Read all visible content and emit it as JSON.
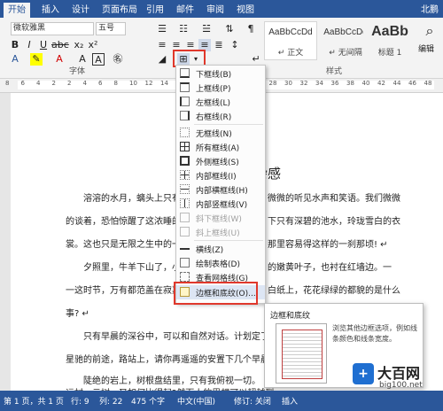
{
  "tabs": [
    "开始",
    "插入",
    "设计",
    "页面布局",
    "引用",
    "邮件",
    "审阅",
    "视图"
  ],
  "active_tab": "开始",
  "user_hint": "北鹏",
  "ribbon": {
    "font_name": "微软雅黑",
    "font_size": "五号",
    "font_group": "字体",
    "styles_group": "样式",
    "editing_label": "编辑",
    "styles": [
      {
        "preview": "AaBbCcDd",
        "name": "↵ 正文"
      },
      {
        "preview": "AaBbCcDd",
        "name": "↵ 无间隔"
      },
      {
        "preview": "AaBb",
        "name": "标题 1"
      }
    ]
  },
  "ruler_ticks": [
    "8",
    "6",
    "4",
    "2",
    "2",
    "4",
    "6",
    "8",
    "10",
    "12",
    "14",
    "16",
    "18",
    "20",
    "22",
    "24",
    "26",
    "28",
    "30",
    "32",
    "34",
    "36",
    "38",
    "40",
    "42",
    "44",
    "46",
    "48"
  ],
  "document": {
    "title_fragment": "中杂感",
    "lines": [
      "溶溶的水月，螭头上只有",
      "微微的听见水声和笑语。我们微微",
      "的谈着，恐怕惊醒了这浓睡的世",
      "下只有深碧的池水，玲珑雪白的衣",
      "裳。这也只是无限之生中的一",
      "那里容易得这样的一刹那顷! ↵",
      "夕照里，牛羊下山了，小",
      "的嫩黄叶子，也衬在红墙边。一",
      "一这时节，万有都范盖在寂嘉",
      "白纸上，花花绿绿的都貌的是什么",
      "事? ↵",
      "只有早晨的深谷中，可以和自然对话。计划定了，将",
      "星驰的前途，路站上，请你再遥遥的安置下几个早晨的",
      "陡绝的岩上，树根盘结里，只有我俯视一切。 ",
      "远村，云树，又如何比得起?然而人的思想可以超越到"
    ]
  },
  "border_menu": {
    "items": [
      {
        "label": "下框线(B)",
        "disabled": false
      },
      {
        "label": "上框线(P)",
        "disabled": false
      },
      {
        "label": "左框线(L)",
        "disabled": false
      },
      {
        "label": "右框线(R)",
        "disabled": false
      },
      {
        "label": "无框线(N)",
        "disabled": false
      },
      {
        "label": "所有框线(A)",
        "disabled": false
      },
      {
        "label": "外侧框线(S)",
        "disabled": false
      },
      {
        "label": "内部框线(I)",
        "disabled": false
      },
      {
        "label": "内部横框线(H)",
        "disabled": false
      },
      {
        "label": "内部竖框线(V)",
        "disabled": false
      },
      {
        "label": "斜下框线(W)",
        "disabled": true
      },
      {
        "label": "斜上框线(U)",
        "disabled": true
      },
      {
        "label": "横线(Z)",
        "disabled": false
      },
      {
        "label": "绘制表格(D)",
        "disabled": false
      },
      {
        "label": "查看网格线(G)",
        "disabled": false
      },
      {
        "label": "边框和底纹(O)...",
        "disabled": false
      }
    ]
  },
  "tooltip": {
    "title": "边框和底纹",
    "description": "浏览其他边框选项，例如线条颜色和线条宽度。"
  },
  "status_bar": {
    "page": "第 1 页，共 1 页",
    "line": "行: 9",
    "column": "列: 22",
    "words": "475 个字",
    "language": "中文(中国)",
    "track": "修订: 关闭",
    "mode": "插入"
  },
  "watermark": {
    "name": "大百网",
    "url": "big100.net"
  },
  "colors": {
    "ribbon_blue": "#2b579a",
    "highlight_red": "#e0382c"
  }
}
